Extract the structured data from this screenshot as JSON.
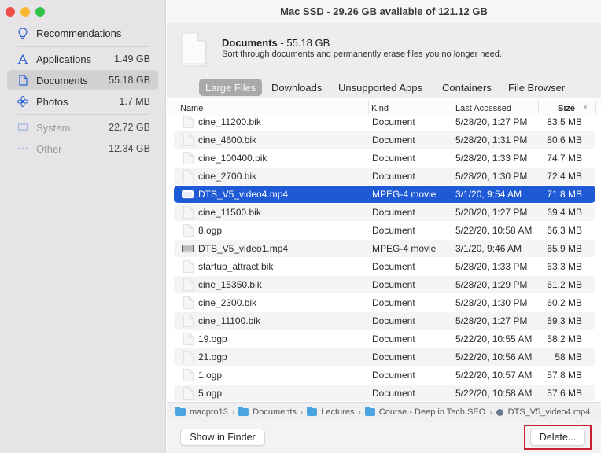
{
  "window": {
    "title": "Mac SSD - 29.26 GB available of 121.12 GB"
  },
  "sidebar": {
    "items": [
      {
        "label": "Recommendations",
        "size": "",
        "icon": "lightbulb-icon"
      },
      {
        "label": "Applications",
        "size": "1.49 GB",
        "icon": "applications-icon"
      },
      {
        "label": "Documents",
        "size": "55.18 GB",
        "icon": "document-icon",
        "active": true
      },
      {
        "label": "Photos",
        "size": "1.7 MB",
        "icon": "photos-flower-icon"
      },
      {
        "label": "System",
        "size": "22.72 GB",
        "icon": "laptop-icon"
      },
      {
        "label": "Other",
        "size": "12.34 GB",
        "icon": "ellipsis-icon"
      }
    ]
  },
  "header": {
    "title": "Documents",
    "separator": " - ",
    "size": "55.18 GB",
    "subtitle": "Sort through documents and permanently erase files you no longer need."
  },
  "tabs": [
    {
      "label": "Large Files",
      "active": true
    },
    {
      "label": "Downloads"
    },
    {
      "label": "Unsupported Apps"
    },
    {
      "label": "Containers"
    },
    {
      "label": "File Browser"
    }
  ],
  "table": {
    "columns": {
      "name": "Name",
      "kind": "Kind",
      "last_accessed": "Last Accessed",
      "size": "Size"
    },
    "rows": [
      {
        "name": "cine_11200.bik",
        "kind": "Document",
        "date": "5/28/20, 1:27 PM",
        "size": "83.5 MB",
        "type": "doc"
      },
      {
        "name": "cine_4600.bik",
        "kind": "Document",
        "date": "5/28/20, 1:31 PM",
        "size": "80.6 MB",
        "type": "doc"
      },
      {
        "name": "cine_100400.bik",
        "kind": "Document",
        "date": "5/28/20, 1:33 PM",
        "size": "74.7 MB",
        "type": "doc"
      },
      {
        "name": "cine_2700.bik",
        "kind": "Document",
        "date": "5/28/20, 1:30 PM",
        "size": "72.4 MB",
        "type": "doc"
      },
      {
        "name": "DTS_V5_video4.mp4",
        "kind": "MPEG-4 movie",
        "date": "3/1/20, 9:54 AM",
        "size": "71.8 MB",
        "type": "video",
        "selected": true
      },
      {
        "name": "cine_11500.bik",
        "kind": "Document",
        "date": "5/28/20, 1:27 PM",
        "size": "69.4 MB",
        "type": "doc"
      },
      {
        "name": "8.ogp",
        "kind": "Document",
        "date": "5/22/20, 10:58 AM",
        "size": "66.3 MB",
        "type": "doc"
      },
      {
        "name": "DTS_V5_video1.mp4",
        "kind": "MPEG-4 movie",
        "date": "3/1/20, 9:46 AM",
        "size": "65.9 MB",
        "type": "video"
      },
      {
        "name": "startup_attract.bik",
        "kind": "Document",
        "date": "5/28/20, 1:33 PM",
        "size": "63.3 MB",
        "type": "doc"
      },
      {
        "name": "cine_15350.bik",
        "kind": "Document",
        "date": "5/28/20, 1:29 PM",
        "size": "61.2 MB",
        "type": "doc"
      },
      {
        "name": "cine_2300.bik",
        "kind": "Document",
        "date": "5/28/20, 1:30 PM",
        "size": "60.2 MB",
        "type": "doc"
      },
      {
        "name": "cine_11100.bik",
        "kind": "Document",
        "date": "5/28/20, 1:27 PM",
        "size": "59.3 MB",
        "type": "doc"
      },
      {
        "name": "19.ogp",
        "kind": "Document",
        "date": "5/22/20, 10:55 AM",
        "size": "58.2 MB",
        "type": "doc"
      },
      {
        "name": "21.ogp",
        "kind": "Document",
        "date": "5/22/20, 10:56 AM",
        "size": "58 MB",
        "type": "doc"
      },
      {
        "name": "1.ogp",
        "kind": "Document",
        "date": "5/22/20, 10:57 AM",
        "size": "57.8 MB",
        "type": "doc"
      },
      {
        "name": "5.ogp",
        "kind": "Document",
        "date": "5/22/20, 10:58 AM",
        "size": "57.6 MB",
        "type": "doc"
      }
    ]
  },
  "pathbar": {
    "crumbs": [
      {
        "label": "macpro13",
        "icon": "home-folder-icon"
      },
      {
        "label": "Documents",
        "icon": "folder-icon"
      },
      {
        "label": "Lectures",
        "icon": "folder-icon"
      },
      {
        "label": "Course - Deep in Tech SEO",
        "icon": "folder-icon"
      },
      {
        "label": "DTS_V5_video4.mp4",
        "icon": "video-file-icon"
      }
    ]
  },
  "footer": {
    "show_in_finder_label": "Show in Finder",
    "delete_label": "Delete..."
  },
  "colors": {
    "accent": "#1f5ad6",
    "highlight_border": "#c8202f",
    "traffic_red": "#ee4f4a",
    "traffic_yellow": "#f9b72f",
    "traffic_green": "#2fc245"
  }
}
